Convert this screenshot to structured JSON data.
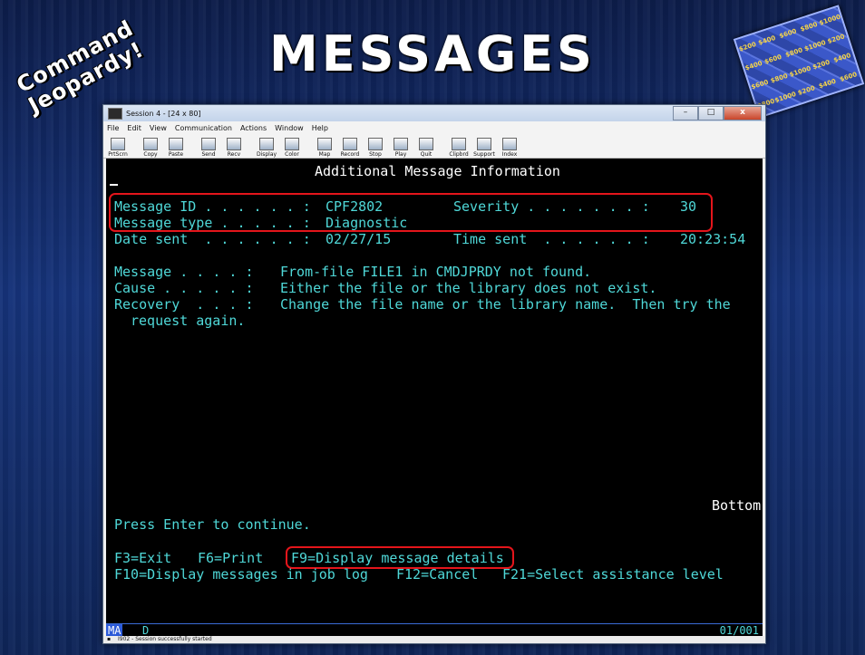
{
  "slide": {
    "title": "Messages",
    "logo_left_line1": "Command",
    "logo_left_line2": "Jeopardy!",
    "board_values": [
      "$200",
      "$400",
      "$600",
      "$800",
      "$1000"
    ]
  },
  "window": {
    "title": "Session 4 - [24 x 80]",
    "buttons": {
      "minimize": "–",
      "maximize": "□",
      "close": "x"
    },
    "menu": [
      "File",
      "Edit",
      "View",
      "Communication",
      "Actions",
      "Window",
      "Help"
    ],
    "toolbar": [
      "PrtScrn",
      "Copy",
      "Paste",
      "Send",
      "Recv",
      "Display",
      "Color",
      "Map",
      "Record",
      "Stop",
      "Play",
      "Quit",
      "Clipbrd",
      "Support",
      "Index"
    ]
  },
  "terminal": {
    "header": "Additional Message Information",
    "fields": [
      {
        "label": "Message ID . . . . . . :",
        "value": "CPF2802",
        "label2": "Severity . . . . . . . :",
        "value2": "30"
      },
      {
        "label": "Message type . . . . . :",
        "value": "Diagnostic"
      },
      {
        "label": "Date sent  . . . . . . :",
        "value": "02/27/15",
        "label2": "Time sent  . . . . . . :",
        "value2": "20:23:54"
      }
    ],
    "details": [
      {
        "label": "Message . . . . :",
        "text": "From-file FILE1 in CMDJPRDY not found."
      },
      {
        "label": "Cause . . . . . :",
        "text": "Either the file or the library does not exist."
      },
      {
        "label": "Recovery  . . . :",
        "text": "Change the file name or the library name.  Then try the"
      }
    ],
    "recovery_cont": "request again.",
    "bottom": "Bottom",
    "press_enter": "Press Enter to continue.",
    "fkeys_row1": {
      "f3": "F3=Exit",
      "f6": "F6=Print",
      "f9": "F9=Display message details"
    },
    "fkeys_row2": {
      "f10": "F10=Display messages in job log",
      "f12": "F12=Cancel",
      "f21": "F21=Select assistance level"
    }
  },
  "status": {
    "mode": "MA",
    "indicator": "D",
    "position": "01/001"
  },
  "footer": {
    "text": "I902 - Session successfully started"
  },
  "colors": {
    "terminal_text": "#4fd8d8",
    "highlight": "#e4151b",
    "terminal_bg": "#000000"
  }
}
